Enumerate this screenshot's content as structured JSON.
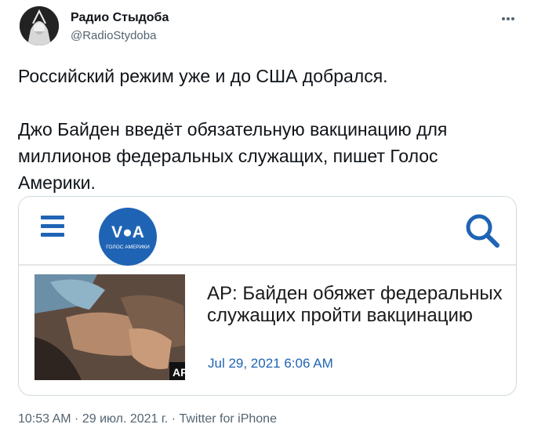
{
  "author": {
    "name": "Радио Стыдоба",
    "handle": "@RadioStydoba"
  },
  "tweet": {
    "text": "Российский режим уже и до США добрался.\n\nДжо Байден введёт обязательную вакцинацию для миллионов федеральных служащих, пишет Голос Америки."
  },
  "card": {
    "logo_text": "V●A",
    "logo_subtext": "ГОЛОС АМЕРИКИ",
    "image_caption": "AP",
    "title": "AP: Байден обяжет федеральных служащих пройти вакцинацию",
    "date": "Jul 29, 2021 6:06 AM",
    "brand_color": "#1f64b4"
  },
  "meta": {
    "time": "10:53 AM",
    "separator": " · ",
    "date": "29 июл. 2021 г.",
    "source": "Twitter for iPhone"
  },
  "icons": [
    "more-options-icon",
    "hamburger-menu-icon",
    "voa-logo-icon",
    "search-icon"
  ]
}
